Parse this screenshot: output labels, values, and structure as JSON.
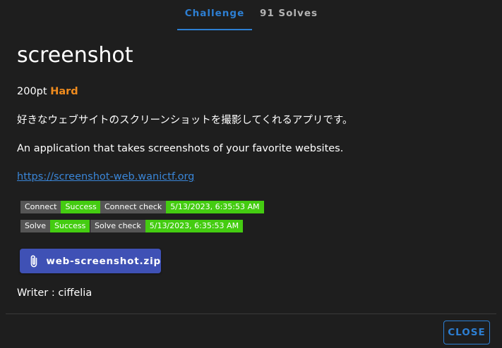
{
  "tabs": [
    {
      "label": "Challenge",
      "active": true
    },
    {
      "label": "91 Solves",
      "active": false
    }
  ],
  "challenge": {
    "title": "screenshot",
    "points": "200pt",
    "difficulty": "Hard",
    "description_ja": "好きなウェブサイトのスクリーンショットを撮影してくれるアプリです。",
    "description_en": "An application that takes screenshots of your favorite websites.",
    "url": "https://screenshot-web.wanictf.org",
    "writer": "Writer : ciffelia"
  },
  "badges": {
    "connect": {
      "label": "Connect",
      "value": "Success"
    },
    "connect_check": {
      "label": "Connect check",
      "value": "5/13/2023, 6:35:53 AM"
    },
    "solve": {
      "label": "Solve",
      "value": "Success"
    },
    "solve_check": {
      "label": "Solve check",
      "value": "5/13/2023, 6:35:53 AM"
    }
  },
  "attachment": {
    "icon": "paperclip-icon",
    "label": "web-screenshot.zip"
  },
  "footer": {
    "close_label": "CLOSE"
  },
  "colors": {
    "background": "#1e1e1e",
    "accent": "#2d7fd3",
    "difficulty": "#f08c1e",
    "badge_label": "#555555",
    "badge_success": "#44cc11",
    "file_button": "#3f51b5"
  }
}
